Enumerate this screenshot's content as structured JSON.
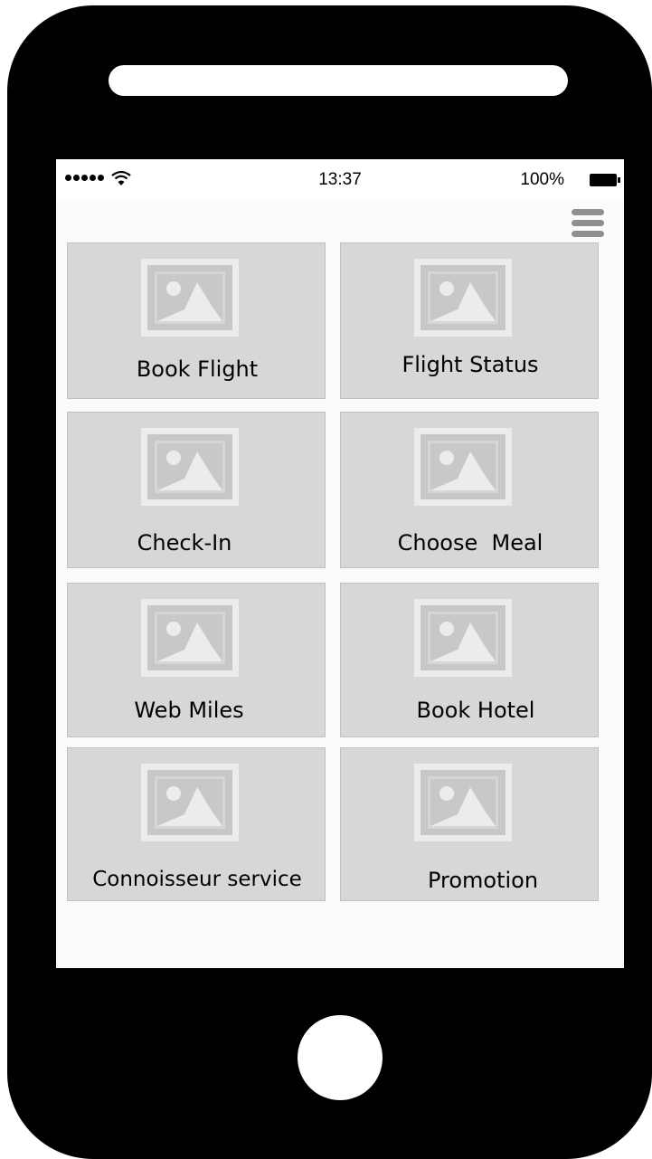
{
  "device": {
    "frame_color": "#000000",
    "screen_bg": "#fbfbfb",
    "tile_bg": "#d7d7d7"
  },
  "status_bar": {
    "time": "13:37",
    "battery": "100%",
    "signal_icon": "signal-dots-icon",
    "wifi_icon": "wifi-icon",
    "battery_icon": "battery-full-icon"
  },
  "header": {
    "menu_icon": "hamburger-menu-icon"
  },
  "tiles": [
    {
      "label": "Book Flight",
      "icon": "image-placeholder-icon"
    },
    {
      "label": "Flight Status",
      "icon": "image-placeholder-icon"
    },
    {
      "label": "Check-In",
      "icon": "image-placeholder-icon"
    },
    {
      "label": "Choose  Meal",
      "icon": "image-placeholder-icon"
    },
    {
      "label": "Web Miles",
      "icon": "image-placeholder-icon"
    },
    {
      "label": "Book Hotel",
      "icon": "image-placeholder-icon"
    },
    {
      "label": "Connoisseur service",
      "icon": "image-placeholder-icon"
    },
    {
      "label": "Promotion",
      "icon": "image-placeholder-icon"
    }
  ]
}
